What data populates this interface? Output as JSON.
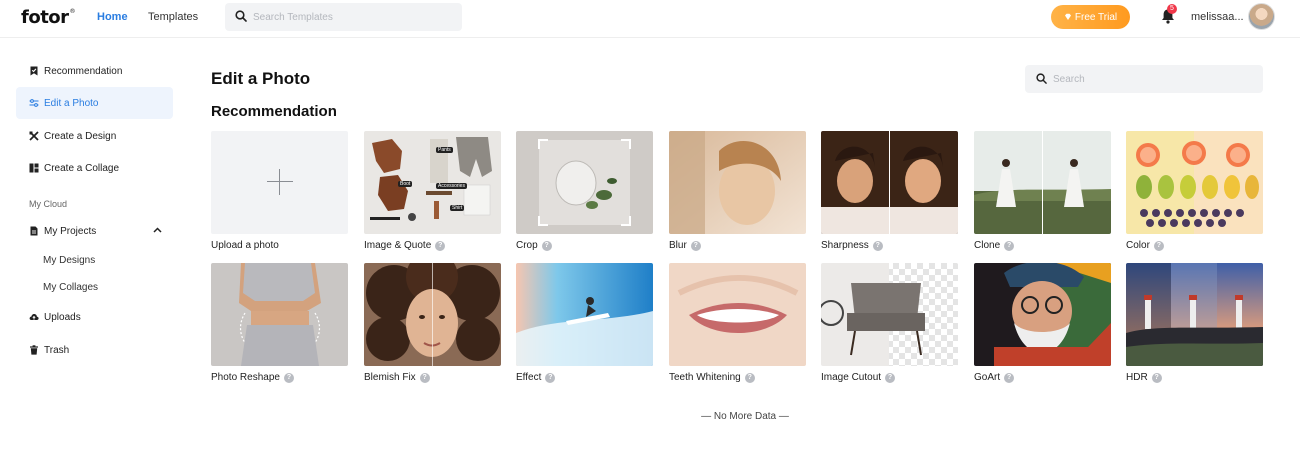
{
  "header": {
    "logo": "fotor",
    "logo_mark": "®",
    "nav": {
      "home": "Home",
      "templates": "Templates"
    },
    "search_placeholder": "Search Templates",
    "free_trial": "Free Trial",
    "notification_count": "5",
    "username": "melissaa...",
    "colors": {
      "accent": "#2a7de1",
      "trial": "#ff9a1f",
      "badge": "#f0384a"
    }
  },
  "sidebar": {
    "items": [
      {
        "label": "Recommendation",
        "icon": "bookmark-icon"
      },
      {
        "label": "Edit a Photo",
        "icon": "sliders-icon",
        "active": true
      },
      {
        "label": "Create a Design",
        "icon": "design-tools-icon"
      },
      {
        "label": "Create a Collage",
        "icon": "collage-icon"
      }
    ],
    "section_label": "My Cloud",
    "my_projects": "My Projects",
    "sub_items": [
      "My Designs",
      "My Collages"
    ],
    "uploads": "Uploads",
    "trash": "Trash"
  },
  "main": {
    "title": "Edit a Photo",
    "section": "Recommendation",
    "search_placeholder": "Search",
    "row1": [
      {
        "label": "Upload a photo",
        "help": false
      },
      {
        "label": "Image & Quote",
        "help": true
      },
      {
        "label": "Crop",
        "help": true
      },
      {
        "label": "Blur",
        "help": true
      },
      {
        "label": "Sharpness",
        "help": true
      },
      {
        "label": "Clone",
        "help": true
      },
      {
        "label": "Color",
        "help": true
      }
    ],
    "row2": [
      {
        "label": "Photo Reshape",
        "help": true
      },
      {
        "label": "Blemish Fix",
        "help": true
      },
      {
        "label": "Effect",
        "help": true
      },
      {
        "label": "Teeth Whitening",
        "help": true
      },
      {
        "label": "Image Cutout",
        "help": true
      },
      {
        "label": "GoArt",
        "help": true
      },
      {
        "label": "HDR",
        "help": true
      }
    ],
    "thumb_tags": [
      "Pants",
      "Accessories",
      "Boot",
      "Shirt"
    ],
    "help_glyph": "?",
    "footer": "— No More Data —"
  }
}
